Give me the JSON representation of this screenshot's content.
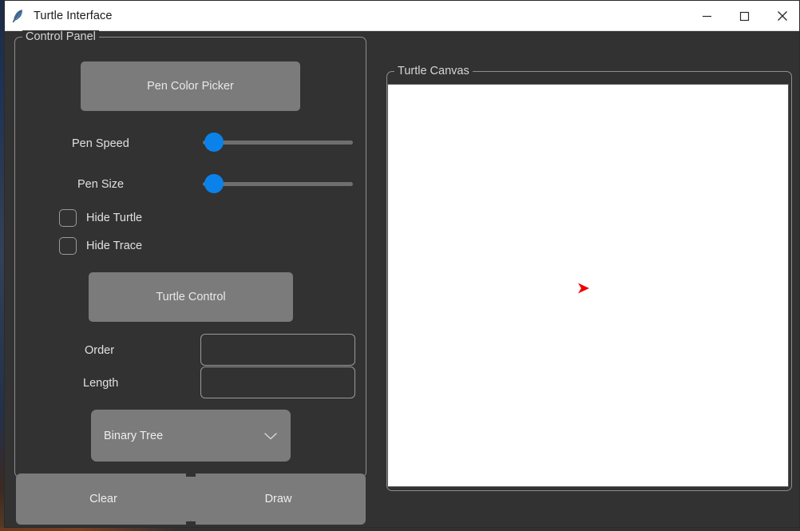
{
  "window": {
    "title": "Turtle Interface",
    "icon": "python-feather-icon",
    "controls": {
      "minimize": "minimize-icon",
      "maximize": "maximize-icon",
      "close": "close-icon"
    }
  },
  "control_panel": {
    "legend": "Control Panel",
    "pen_color_picker": {
      "label": "Pen Color Picker"
    },
    "pen_speed": {
      "label": "Pen Speed",
      "value": 0,
      "min": 0,
      "max": 100
    },
    "pen_size": {
      "label": "Pen Size",
      "value": 0,
      "min": 0,
      "max": 100
    },
    "hide_turtle": {
      "label": "Hide Turtle",
      "checked": false
    },
    "hide_trace": {
      "label": "Hide Trace",
      "checked": false
    },
    "turtle_control": {
      "label": "Turtle Control"
    },
    "order": {
      "label": "Order",
      "value": "",
      "placeholder": ""
    },
    "length": {
      "label": "Length",
      "value": "",
      "placeholder": ""
    },
    "shape_select": {
      "value": "Binary Tree",
      "icon": "chevron-down-icon"
    },
    "clear_button": {
      "label": "Clear"
    },
    "draw_button": {
      "label": "Draw"
    }
  },
  "canvas_panel": {
    "legend": "Turtle Canvas",
    "turtle": {
      "icon": "turtle-arrow-icon",
      "color": "#ee0000",
      "heading": "east"
    },
    "background": "#ffffff"
  },
  "colors": {
    "window_background": "#323232",
    "titlebar_background": "#ffffff",
    "button_gray": "#7b7b7b",
    "slider_accent": "#0b82ea",
    "frame_border": "#8d8d8d",
    "text": "#e0e0e0",
    "turtle_red": "#ee0000"
  }
}
